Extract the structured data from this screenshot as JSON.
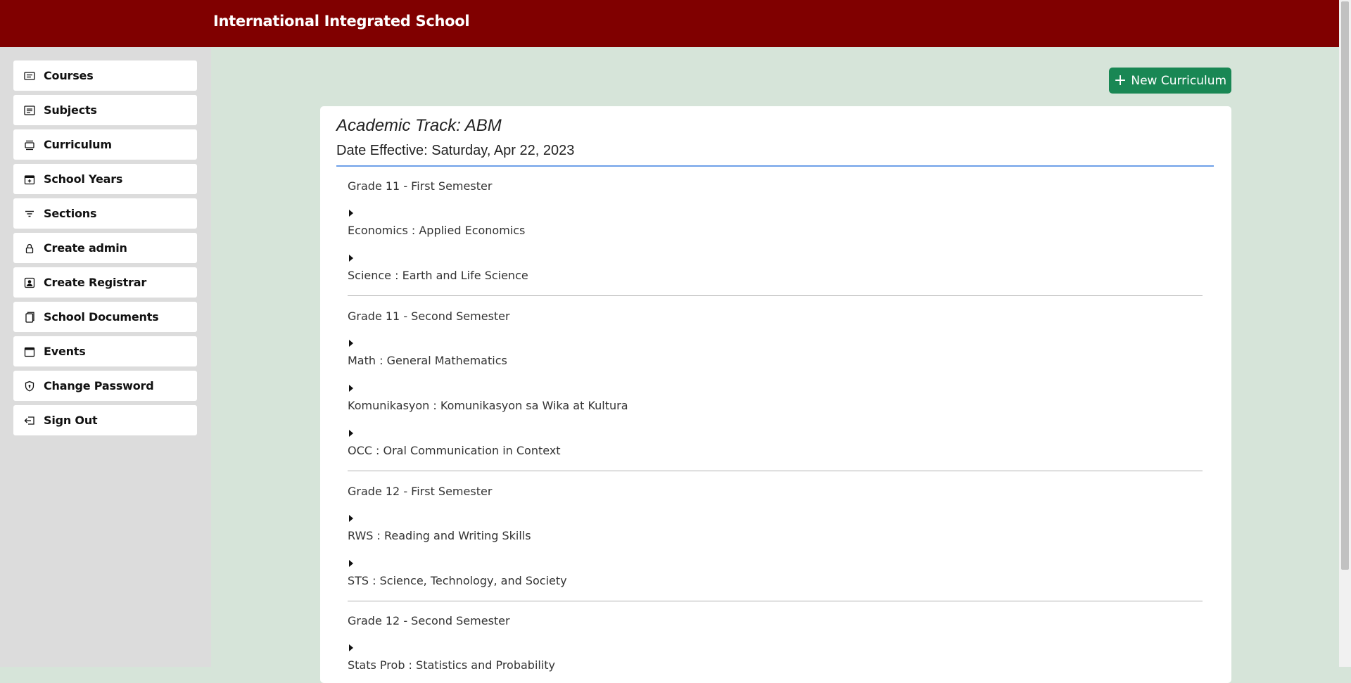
{
  "header": {
    "title": "International Integrated School"
  },
  "sidebar": {
    "items": [
      {
        "label": "Courses",
        "icon": "courses-icon"
      },
      {
        "label": "Subjects",
        "icon": "subjects-icon"
      },
      {
        "label": "Curriculum",
        "icon": "curriculum-icon"
      },
      {
        "label": "School Years",
        "icon": "calendar-plus-icon"
      },
      {
        "label": "Sections",
        "icon": "filter-icon"
      },
      {
        "label": "Create admin",
        "icon": "lock-icon"
      },
      {
        "label": "Create Registrar",
        "icon": "person-badge-icon"
      },
      {
        "label": "School Documents",
        "icon": "documents-icon"
      },
      {
        "label": "Events",
        "icon": "calendar-icon"
      },
      {
        "label": "Change Password",
        "icon": "shield-icon"
      },
      {
        "label": "Sign Out",
        "icon": "sign-out-icon"
      }
    ]
  },
  "toolbar": {
    "new_label": "New Curriculum",
    "plus": "+"
  },
  "curriculum": {
    "track": "Academic Track: ABM",
    "date_effective": "Date Effective: Saturday, Apr 22, 2023",
    "semesters": [
      {
        "title": "Grade 11 - First Semester",
        "subjects": [
          "Economics : Applied Economics",
          "Science : Earth and Life Science"
        ]
      },
      {
        "title": "Grade 11 - Second Semester",
        "subjects": [
          "Math : General Mathematics",
          "Komunikasyon : Komunikasyon sa Wika at Kultura",
          "OCC : Oral Communication in Context"
        ]
      },
      {
        "title": "Grade 12 - First Semester",
        "subjects": [
          "RWS : Reading and Writing Skills",
          "STS : Science, Technology, and Society"
        ]
      },
      {
        "title": "Grade 12 - Second Semester",
        "subjects": [
          "Stats Prob : Statistics and Probability"
        ]
      }
    ]
  },
  "colors": {
    "header": "#800000",
    "sidebar": "#dcdcdc",
    "content_bg": "#d6e4d9",
    "button": "#198754",
    "date_rule": "#6ea0e8"
  }
}
